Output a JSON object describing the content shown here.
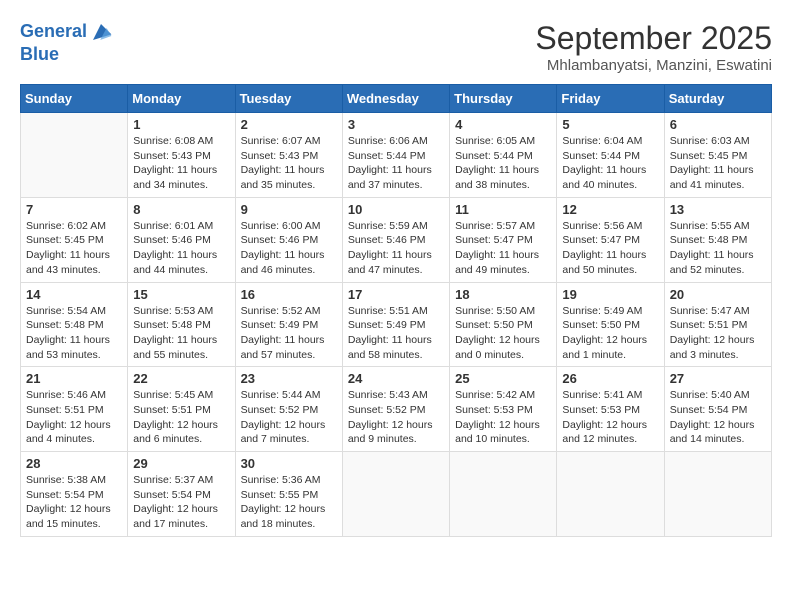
{
  "header": {
    "logo_line1": "General",
    "logo_line2": "Blue",
    "month": "September 2025",
    "location": "Mhlambanyatsi, Manzini, Eswatini"
  },
  "weekdays": [
    "Sunday",
    "Monday",
    "Tuesday",
    "Wednesday",
    "Thursday",
    "Friday",
    "Saturday"
  ],
  "weeks": [
    [
      {
        "day": "",
        "info": ""
      },
      {
        "day": "1",
        "info": "Sunrise: 6:08 AM\nSunset: 5:43 PM\nDaylight: 11 hours\nand 34 minutes."
      },
      {
        "day": "2",
        "info": "Sunrise: 6:07 AM\nSunset: 5:43 PM\nDaylight: 11 hours\nand 35 minutes."
      },
      {
        "day": "3",
        "info": "Sunrise: 6:06 AM\nSunset: 5:44 PM\nDaylight: 11 hours\nand 37 minutes."
      },
      {
        "day": "4",
        "info": "Sunrise: 6:05 AM\nSunset: 5:44 PM\nDaylight: 11 hours\nand 38 minutes."
      },
      {
        "day": "5",
        "info": "Sunrise: 6:04 AM\nSunset: 5:44 PM\nDaylight: 11 hours\nand 40 minutes."
      },
      {
        "day": "6",
        "info": "Sunrise: 6:03 AM\nSunset: 5:45 PM\nDaylight: 11 hours\nand 41 minutes."
      }
    ],
    [
      {
        "day": "7",
        "info": "Sunrise: 6:02 AM\nSunset: 5:45 PM\nDaylight: 11 hours\nand 43 minutes."
      },
      {
        "day": "8",
        "info": "Sunrise: 6:01 AM\nSunset: 5:46 PM\nDaylight: 11 hours\nand 44 minutes."
      },
      {
        "day": "9",
        "info": "Sunrise: 6:00 AM\nSunset: 5:46 PM\nDaylight: 11 hours\nand 46 minutes."
      },
      {
        "day": "10",
        "info": "Sunrise: 5:59 AM\nSunset: 5:46 PM\nDaylight: 11 hours\nand 47 minutes."
      },
      {
        "day": "11",
        "info": "Sunrise: 5:57 AM\nSunset: 5:47 PM\nDaylight: 11 hours\nand 49 minutes."
      },
      {
        "day": "12",
        "info": "Sunrise: 5:56 AM\nSunset: 5:47 PM\nDaylight: 11 hours\nand 50 minutes."
      },
      {
        "day": "13",
        "info": "Sunrise: 5:55 AM\nSunset: 5:48 PM\nDaylight: 11 hours\nand 52 minutes."
      }
    ],
    [
      {
        "day": "14",
        "info": "Sunrise: 5:54 AM\nSunset: 5:48 PM\nDaylight: 11 hours\nand 53 minutes."
      },
      {
        "day": "15",
        "info": "Sunrise: 5:53 AM\nSunset: 5:48 PM\nDaylight: 11 hours\nand 55 minutes."
      },
      {
        "day": "16",
        "info": "Sunrise: 5:52 AM\nSunset: 5:49 PM\nDaylight: 11 hours\nand 57 minutes."
      },
      {
        "day": "17",
        "info": "Sunrise: 5:51 AM\nSunset: 5:49 PM\nDaylight: 11 hours\nand 58 minutes."
      },
      {
        "day": "18",
        "info": "Sunrise: 5:50 AM\nSunset: 5:50 PM\nDaylight: 12 hours\nand 0 minutes."
      },
      {
        "day": "19",
        "info": "Sunrise: 5:49 AM\nSunset: 5:50 PM\nDaylight: 12 hours\nand 1 minute."
      },
      {
        "day": "20",
        "info": "Sunrise: 5:47 AM\nSunset: 5:51 PM\nDaylight: 12 hours\nand 3 minutes."
      }
    ],
    [
      {
        "day": "21",
        "info": "Sunrise: 5:46 AM\nSunset: 5:51 PM\nDaylight: 12 hours\nand 4 minutes."
      },
      {
        "day": "22",
        "info": "Sunrise: 5:45 AM\nSunset: 5:51 PM\nDaylight: 12 hours\nand 6 minutes."
      },
      {
        "day": "23",
        "info": "Sunrise: 5:44 AM\nSunset: 5:52 PM\nDaylight: 12 hours\nand 7 minutes."
      },
      {
        "day": "24",
        "info": "Sunrise: 5:43 AM\nSunset: 5:52 PM\nDaylight: 12 hours\nand 9 minutes."
      },
      {
        "day": "25",
        "info": "Sunrise: 5:42 AM\nSunset: 5:53 PM\nDaylight: 12 hours\nand 10 minutes."
      },
      {
        "day": "26",
        "info": "Sunrise: 5:41 AM\nSunset: 5:53 PM\nDaylight: 12 hours\nand 12 minutes."
      },
      {
        "day": "27",
        "info": "Sunrise: 5:40 AM\nSunset: 5:54 PM\nDaylight: 12 hours\nand 14 minutes."
      }
    ],
    [
      {
        "day": "28",
        "info": "Sunrise: 5:38 AM\nSunset: 5:54 PM\nDaylight: 12 hours\nand 15 minutes."
      },
      {
        "day": "29",
        "info": "Sunrise: 5:37 AM\nSunset: 5:54 PM\nDaylight: 12 hours\nand 17 minutes."
      },
      {
        "day": "30",
        "info": "Sunrise: 5:36 AM\nSunset: 5:55 PM\nDaylight: 12 hours\nand 18 minutes."
      },
      {
        "day": "",
        "info": ""
      },
      {
        "day": "",
        "info": ""
      },
      {
        "day": "",
        "info": ""
      },
      {
        "day": "",
        "info": ""
      }
    ]
  ]
}
